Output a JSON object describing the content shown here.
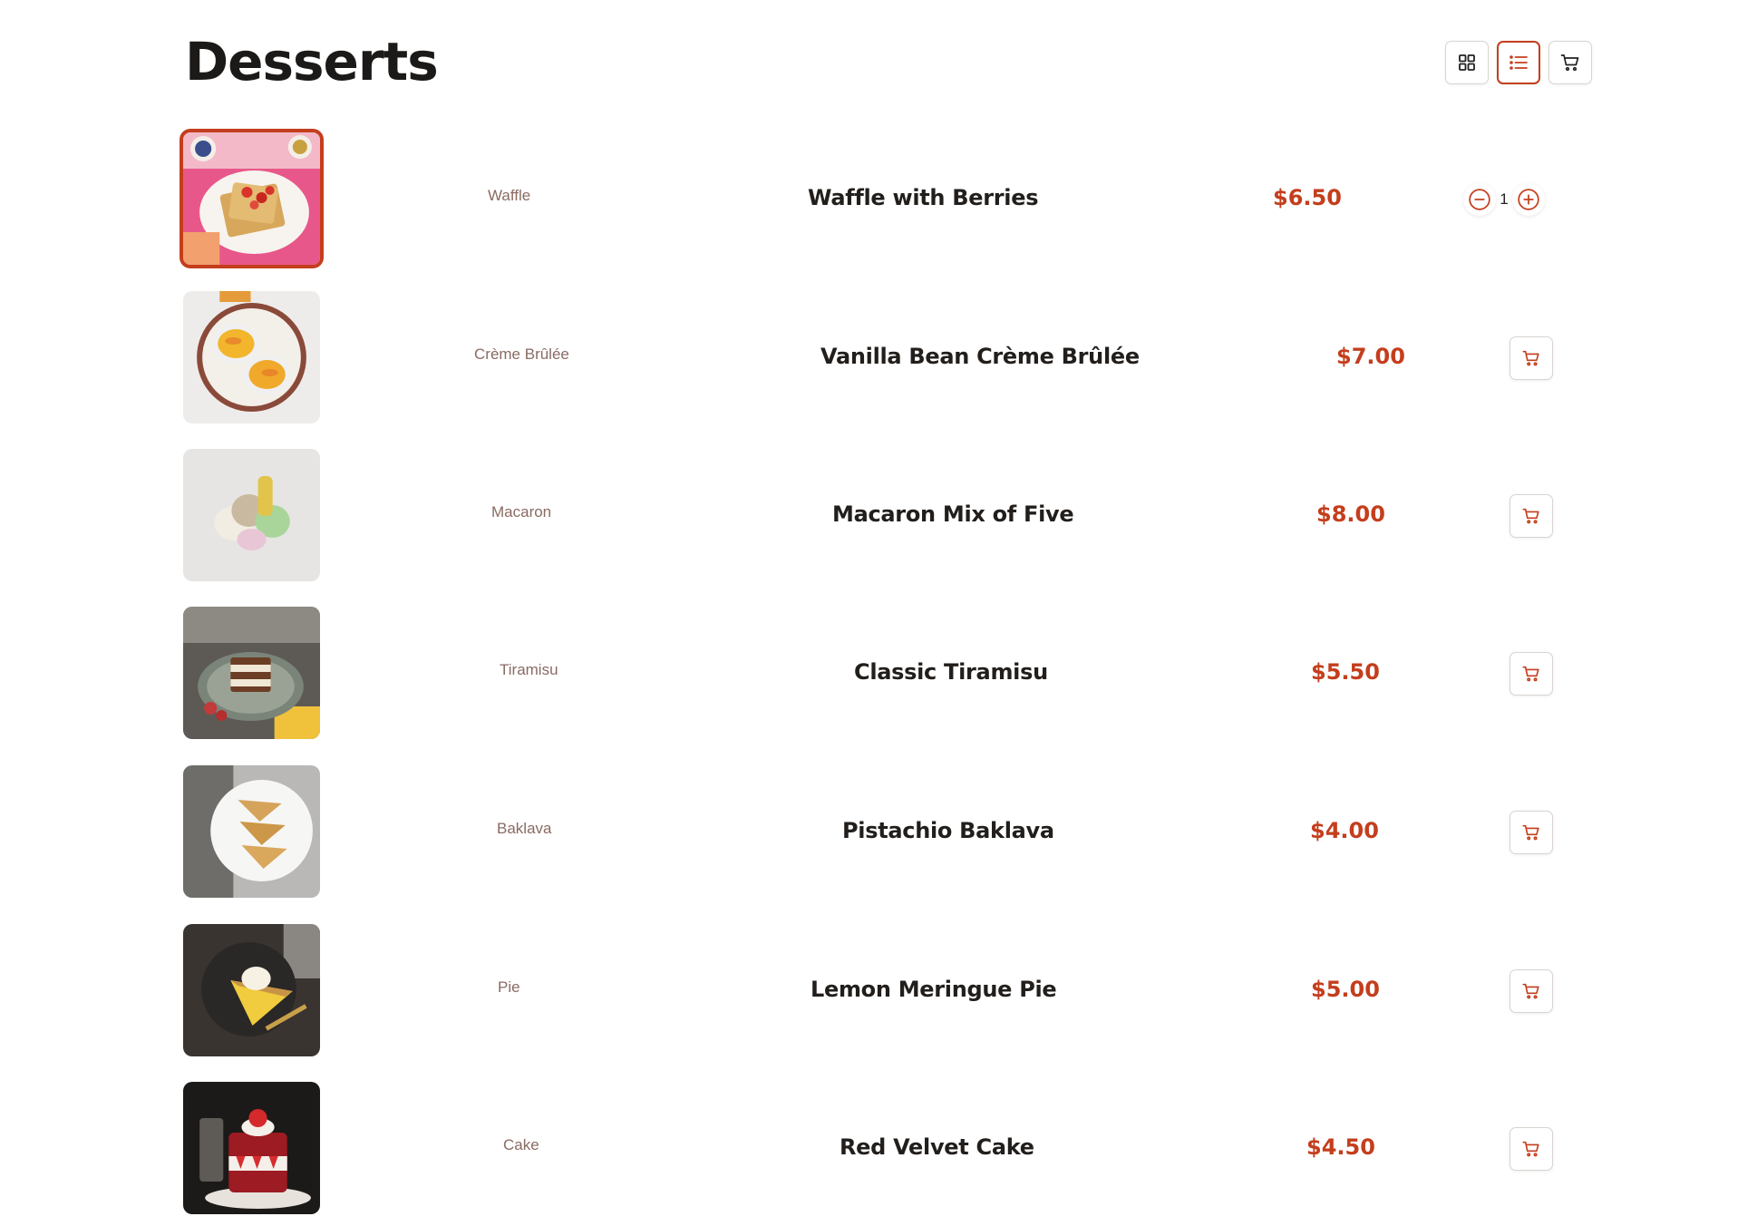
{
  "page": {
    "title": "Desserts"
  },
  "colors": {
    "accent": "#c43e1d",
    "text": "#1c1a18",
    "category": "#8a6b63",
    "border": "#d9d4d0"
  },
  "view_toggle": {
    "grid_icon": "grid-icon",
    "list_icon": "list-icon",
    "cart_icon": "cart-icon",
    "active": "list"
  },
  "items": [
    {
      "category": "Waffle",
      "name": "Waffle with Berries",
      "price": "$6.50",
      "image": "waffle-photo",
      "in_cart": true,
      "quantity": "1"
    },
    {
      "category": "Crème Brûlée",
      "name": "Vanilla Bean Crème Brûlée",
      "price": "$7.00",
      "image": "creme-brulee-photo",
      "in_cart": false
    },
    {
      "category": "Macaron",
      "name": "Macaron Mix of Five",
      "price": "$8.00",
      "image": "macaron-photo",
      "in_cart": false
    },
    {
      "category": "Tiramisu",
      "name": "Classic Tiramisu",
      "price": "$5.50",
      "image": "tiramisu-photo",
      "in_cart": false
    },
    {
      "category": "Baklava",
      "name": "Pistachio Baklava",
      "price": "$4.00",
      "image": "baklava-photo",
      "in_cart": false
    },
    {
      "category": "Pie",
      "name": "Lemon Meringue Pie",
      "price": "$5.00",
      "image": "pie-photo",
      "in_cart": false
    },
    {
      "category": "Cake",
      "name": "Red Velvet Cake",
      "price": "$4.50",
      "image": "cake-photo",
      "in_cart": false
    }
  ]
}
